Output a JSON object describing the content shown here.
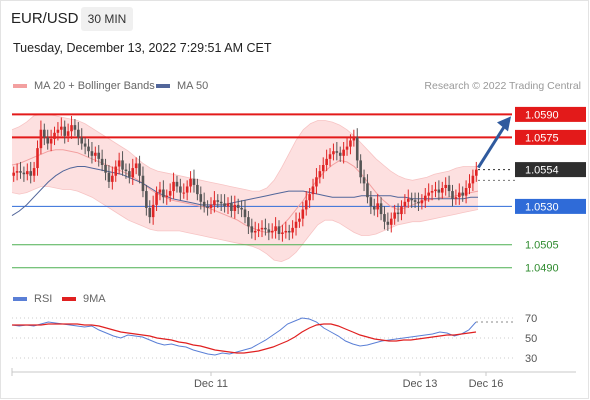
{
  "header": {
    "symbol": "EUR/USD",
    "timeframe": "30 MIN",
    "datetime": "Tuesday, December 13, 2022 7:29:51 AM CET"
  },
  "legend": {
    "ma20_bb": "MA 20 + Bollinger Bands",
    "ma50": "MA 50",
    "research": "Research © 2022 Trading Central",
    "rsi": "RSI",
    "rsi_ma": "9MA"
  },
  "colors": {
    "ma20": "#f3a0a0",
    "bb_fill": "#fde0e0",
    "ma50": "#52669a",
    "resistance": "#e31a1a",
    "pivot": "#2f6bd8",
    "support": "#4caf50",
    "current": "#2e2e2e",
    "arrow": "#2f5a9e",
    "bull": "#e02525",
    "bear": "#555555",
    "rsi_line": "#5a7fd6",
    "rsi_ma": "#e02020"
  },
  "chart_data": [
    {
      "type": "line",
      "title": "EUR/USD",
      "subtitle": "30 MIN",
      "ylim": [
        1.0482,
        1.0602
      ],
      "x_ticks": [
        "Dec 11",
        "Dec 13",
        "Dec 16"
      ],
      "levels": [
        {
          "label": "1.0590",
          "value": 1.059,
          "kind": "resistance"
        },
        {
          "label": "1.0575",
          "value": 1.0575,
          "kind": "resistance"
        },
        {
          "label": "1.0554",
          "value": 1.0554,
          "kind": "current"
        },
        {
          "label": "1.0530",
          "value": 1.053,
          "kind": "pivot"
        },
        {
          "label": "1.0505",
          "value": 1.0505,
          "kind": "support"
        },
        {
          "label": "1.0490",
          "value": 1.049,
          "kind": "support"
        }
      ],
      "candles_close": [
        1.0552,
        1.0553,
        1.0552,
        1.0551,
        1.0553,
        1.055,
        1.0555,
        1.0568,
        1.058,
        1.0575,
        1.0571,
        1.0574,
        1.0578,
        1.058,
        1.0582,
        1.0576,
        1.0579,
        1.0583,
        1.058,
        1.0575,
        1.0571,
        1.0569,
        1.0566,
        1.0563,
        1.0565,
        1.0561,
        1.0557,
        1.0552,
        1.0546,
        1.055,
        1.0556,
        1.056,
        1.0554,
        1.0553,
        1.0549,
        1.0555,
        1.0558,
        1.055,
        1.054,
        1.0529,
        1.0523,
        1.0531,
        1.0539,
        1.0541,
        1.0536,
        1.0537,
        1.054,
        1.0546,
        1.0543,
        1.0539,
        1.0539,
        1.0543,
        1.0548,
        1.0544,
        1.0538,
        1.0533,
        1.053,
        1.0529,
        1.0531,
        1.0534,
        1.0533,
        1.0532,
        1.053,
        1.0532,
        1.0527,
        1.0531,
        1.0529,
        1.0528,
        1.0523,
        1.0517,
        1.0513,
        1.0514,
        1.0515,
        1.0516,
        1.0515,
        1.0513,
        1.0514,
        1.0517,
        1.0512,
        1.0513,
        1.0514,
        1.0513,
        1.0516,
        1.052,
        1.0522,
        1.0528,
        1.0534,
        1.0538,
        1.0543,
        1.0549,
        1.0553,
        1.0557,
        1.0561,
        1.0564,
        1.0566,
        1.0565,
        1.0563,
        1.0567,
        1.0569,
        1.0573,
        1.0575,
        1.056,
        1.0549,
        1.0545,
        1.0536,
        1.053,
        1.0528,
        1.0532,
        1.0525,
        1.052,
        1.0518,
        1.0522,
        1.0526,
        1.0525,
        1.053,
        1.0533,
        1.0535,
        1.0534,
        1.0533,
        1.0532,
        1.0534,
        1.0537,
        1.0539,
        1.054,
        1.0541,
        1.0539,
        1.0542,
        1.0544,
        1.054,
        1.0535,
        1.0536,
        1.0539,
        1.0537,
        1.0542,
        1.0545,
        1.055,
        1.0554
      ],
      "ma20": [
        1.0557,
        1.0558,
        1.056,
        1.0562,
        1.0564,
        1.0566,
        1.0567,
        1.0567,
        1.0566,
        1.0565,
        1.0563,
        1.0561,
        1.0559,
        1.0557,
        1.0555,
        1.0553,
        1.0551,
        1.0548,
        1.0545,
        1.0541,
        1.0538,
        1.0536,
        1.0534,
        1.0533,
        1.0532,
        1.0531,
        1.053,
        1.0529,
        1.0527,
        1.0525,
        1.0523,
        1.0521,
        1.0518,
        1.0516,
        1.0514,
        1.0513,
        1.0514,
        1.0517,
        1.0522,
        1.0528,
        1.0534,
        1.0541,
        1.0548,
        1.0553,
        1.0557,
        1.056,
        1.0559,
        1.0556,
        1.0551,
        1.0545,
        1.0539,
        1.0534,
        1.053,
        1.0528,
        1.0529,
        1.0531,
        1.0533,
        1.0534,
        1.0535,
        1.0536,
        1.0536,
        1.0537,
        1.0538,
        1.0539,
        1.054
      ],
      "ma50": [
        1.0524,
        1.0527,
        1.0531,
        1.0536,
        1.0541,
        1.0546,
        1.055,
        1.0553,
        1.0555,
        1.0556,
        1.0556,
        1.0555,
        1.0554,
        1.0553,
        1.0552,
        1.0551,
        1.0549,
        1.0547,
        1.0545,
        1.0542,
        1.0539,
        1.0537,
        1.0535,
        1.0534,
        1.0533,
        1.0532,
        1.0531,
        1.0531,
        1.0531,
        1.0531,
        1.0532,
        1.0533,
        1.0534,
        1.0535,
        1.0536,
        1.0537,
        1.0538,
        1.0539,
        1.054,
        1.054,
        1.054,
        1.0539,
        1.0538,
        1.0537,
        1.0536,
        1.0536,
        1.0536,
        1.0536,
        1.0537,
        1.0537,
        1.0537,
        1.0537,
        1.0537,
        1.0536,
        1.0536,
        1.0535,
        1.0535,
        1.0535,
        1.0535,
        1.0535,
        1.0535,
        1.0535,
        1.0535,
        1.0536,
        1.0536
      ],
      "bb_upper": [
        1.058,
        1.0582,
        1.0585,
        1.0589,
        1.059,
        1.059,
        1.0589,
        1.0588,
        1.0587,
        1.0586,
        1.0584,
        1.0581,
        1.0578,
        1.0575,
        1.0572,
        1.0569,
        1.0566,
        1.0562,
        1.0558,
        1.0555,
        1.0553,
        1.0552,
        1.0551,
        1.055,
        1.0549,
        1.0548,
        1.0547,
        1.0546,
        1.0545,
        1.0544,
        1.0543,
        1.0542,
        1.0541,
        1.054,
        1.054,
        1.0542,
        1.0547,
        1.0555,
        1.0564,
        1.0573,
        1.058,
        1.0584,
        1.0586,
        1.0586,
        1.0585,
        1.0583,
        1.058,
        1.0576,
        1.0571,
        1.0566,
        1.0561,
        1.0557,
        1.0553,
        1.055,
        1.0548,
        1.0547,
        1.0548,
        1.0549,
        1.0551,
        1.0552,
        1.0553,
        1.0555,
        1.0556,
        1.0556,
        1.0556
      ],
      "bb_lower": [
        1.0539,
        1.0538,
        1.0539,
        1.0541,
        1.0543,
        1.0543,
        1.0542,
        1.0541,
        1.0541,
        1.054,
        1.0538,
        1.0536,
        1.0533,
        1.053,
        1.0527,
        1.0524,
        1.0521,
        1.0519,
        1.0517,
        1.0515,
        1.0514,
        1.0514,
        1.0514,
        1.0514,
        1.0513,
        1.0512,
        1.0511,
        1.051,
        1.0509,
        1.0508,
        1.0507,
        1.0506,
        1.0505,
        1.0504,
        1.0502,
        1.0499,
        1.0495,
        1.0494,
        1.0496,
        1.05,
        1.0506,
        1.0512,
        1.0518,
        1.0521,
        1.0521,
        1.0519,
        1.0516,
        1.0513,
        1.0511,
        1.0511,
        1.0512,
        1.0514,
        1.0516,
        1.0518,
        1.0519,
        1.052,
        1.052,
        1.0521,
        1.0522,
        1.0523,
        1.0524,
        1.0525,
        1.0526,
        1.0527,
        1.0528
      ],
      "projection": {
        "from": 1.0554,
        "to": 1.059
      }
    },
    {
      "type": "line",
      "title": "RSI",
      "ylim": [
        20,
        80
      ],
      "y_ticks": [
        70,
        50,
        30
      ],
      "series": [
        {
          "name": "RSI",
          "values": [
            63,
            62,
            63,
            62,
            64,
            66,
            65,
            64,
            63,
            62,
            61,
            62,
            58,
            55,
            52,
            50,
            53,
            52,
            51,
            48,
            45,
            43,
            44,
            42,
            41,
            38,
            36,
            34,
            33,
            35,
            34,
            36,
            38,
            40,
            44,
            48,
            53,
            58,
            64,
            67,
            70,
            69,
            66,
            60,
            56,
            52,
            47,
            44,
            42,
            43,
            45,
            47,
            48,
            49,
            50,
            51,
            52,
            53,
            54,
            56,
            55,
            52,
            54,
            58,
            66
          ]
        },
        {
          "name": "9MA",
          "values": [
            63,
            63,
            63,
            63,
            63,
            64,
            64,
            64,
            64,
            64,
            63,
            63,
            62,
            60,
            58,
            56,
            55,
            54,
            53,
            52,
            50,
            49,
            48,
            46,
            45,
            43,
            42,
            40,
            38,
            37,
            36,
            35,
            35,
            36,
            37,
            39,
            41,
            44,
            47,
            51,
            56,
            60,
            63,
            64,
            64,
            62,
            59,
            56,
            53,
            51,
            49,
            48,
            47,
            47,
            48,
            48,
            49,
            50,
            51,
            52,
            53,
            53,
            54,
            55,
            56
          ]
        }
      ]
    }
  ]
}
